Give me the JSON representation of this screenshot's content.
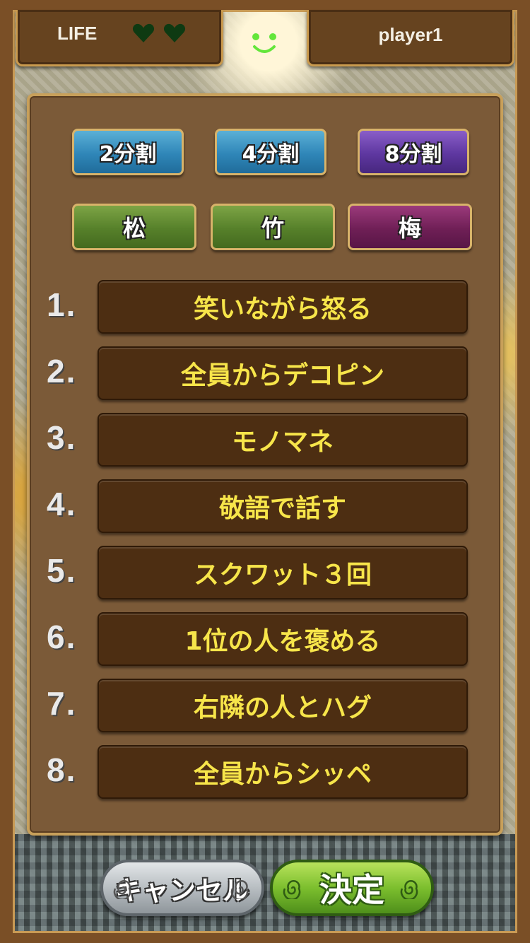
{
  "header": {
    "life_label": "LIFE",
    "life_hearts": 2,
    "player_name": "player1"
  },
  "split_buttons": [
    {
      "label": "2分割",
      "selected": false
    },
    {
      "label": "4分割",
      "selected": false
    },
    {
      "label": "8分割",
      "selected": true
    }
  ],
  "grade_buttons": [
    {
      "label": "松",
      "selected": false
    },
    {
      "label": "竹",
      "selected": false
    },
    {
      "label": "梅",
      "selected": true
    }
  ],
  "penalties": [
    {
      "num": "1.",
      "text": "笑いながら怒る"
    },
    {
      "num": "2.",
      "text": "全員からデコピン"
    },
    {
      "num": "3.",
      "text": "モノマネ"
    },
    {
      "num": "4.",
      "text": "敬語で話す"
    },
    {
      "num": "5.",
      "text": "スクワット３回"
    },
    {
      "num": "6.",
      "text": "1位の人を褒める"
    },
    {
      "num": "7.",
      "text": "右隣の人とハグ"
    },
    {
      "num": "8.",
      "text": "全員からシッペ"
    }
  ],
  "footer": {
    "cancel_label": "キャンセル",
    "ok_label": "決定"
  },
  "colors": {
    "panel": "#7b5a38",
    "row": "#4d2e12",
    "row_text": "#f7e54a",
    "selected": "#5e37a0"
  }
}
